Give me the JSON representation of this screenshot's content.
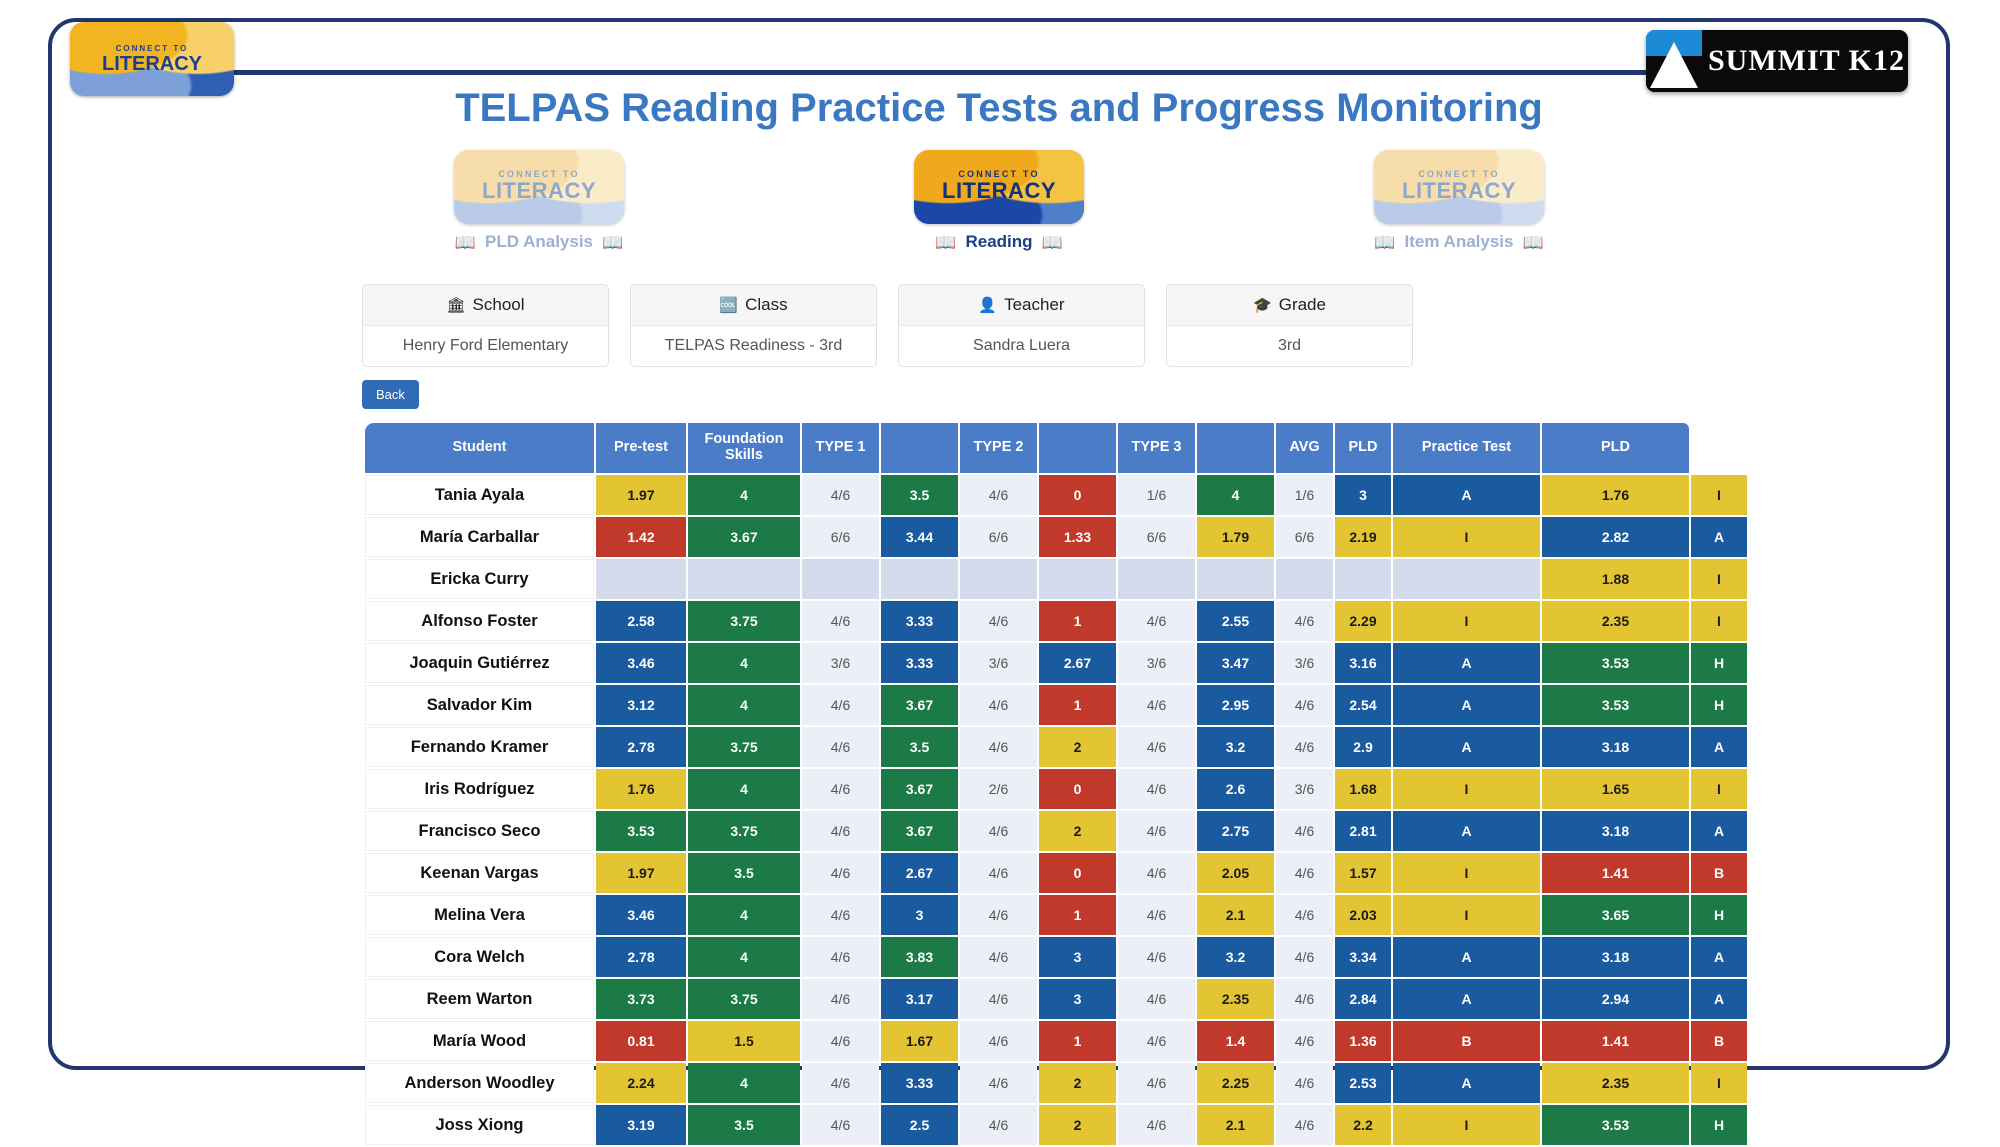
{
  "header": {
    "title": "TELPAS Reading Practice Tests and Progress Monitoring",
    "brand_logo_line1": "CONNECT TO",
    "brand_logo_line2": "LITERACY",
    "partner_logo": "SUMMIT K12"
  },
  "nav": {
    "items": [
      {
        "label": "PLD Analysis",
        "logo_line1": "CONNECT TO",
        "logo_line2": "LITERACY",
        "active": false,
        "icon": "book-icon"
      },
      {
        "label": "Reading",
        "logo_line1": "CONNECT TO",
        "logo_line2": "LITERACY",
        "active": true,
        "icon": "book-icon"
      },
      {
        "label": "Item Analysis",
        "logo_line1": "CONNECT TO",
        "logo_line2": "LITERACY",
        "active": false,
        "icon": "book-icon"
      }
    ]
  },
  "filters": [
    {
      "label": "School",
      "value": "Henry Ford Elementary",
      "icon": "bank-icon"
    },
    {
      "label": "Class",
      "value": "TELPAS Readiness - 3rd",
      "icon": "id-card-icon"
    },
    {
      "label": "Teacher",
      "value": "Sandra Luera",
      "icon": "user-icon"
    },
    {
      "label": "Grade",
      "value": "3rd",
      "icon": "graduation-cap-icon"
    }
  ],
  "back_button": "Back",
  "colors": {
    "frame": "#21366e",
    "title": "#3a78c2",
    "header_blue": "#4a7cc7",
    "cell_blue": "#1a5a9e",
    "cell_green": "#1b7a46",
    "cell_yellow": "#e3c533",
    "cell_red": "#c0392b",
    "cell_empty": "#d3daec",
    "fraction_bg": "#eceff7",
    "button_blue": "#2f6cb5"
  },
  "table": {
    "columns": [
      "Student",
      "Pre-test",
      "Foundation Skills",
      "TYPE 1",
      "",
      "TYPE 2",
      "",
      "TYPE 3",
      "",
      "AVG",
      "PLD",
      "Practice Test",
      "PLD"
    ],
    "column_headers": {
      "student": "Student",
      "pretest": "Pre-test",
      "foundation": "Foundation Skills",
      "foundation_l1": "Foundation",
      "foundation_l2": "Skills",
      "type1": "TYPE 1",
      "type2": "TYPE 2",
      "type3": "TYPE 3",
      "avg": "AVG",
      "pld": "PLD",
      "practice": "Practice Test",
      "pld2": "PLD"
    },
    "rows": [
      {
        "name": "Tania Ayala",
        "cells": [
          {
            "v": "1.97",
            "c": "c-y"
          },
          {
            "v": "4",
            "c": "c-g"
          },
          {
            "v": "4/6",
            "c": "c-f"
          },
          {
            "v": "3.5",
            "c": "c-g"
          },
          {
            "v": "4/6",
            "c": "c-f"
          },
          {
            "v": "0",
            "c": "c-r"
          },
          {
            "v": "1/6",
            "c": "c-f"
          },
          {
            "v": "4",
            "c": "c-g"
          },
          {
            "v": "1/6",
            "c": "c-f"
          },
          {
            "v": "3",
            "c": "c-b"
          },
          {
            "v": "A",
            "c": "c-b"
          },
          {
            "v": "1.76",
            "c": "c-y"
          },
          {
            "v": "I",
            "c": "c-y"
          }
        ]
      },
      {
        "name": "María Carballar",
        "cells": [
          {
            "v": "1.42",
            "c": "c-r"
          },
          {
            "v": "3.67",
            "c": "c-g"
          },
          {
            "v": "6/6",
            "c": "c-f"
          },
          {
            "v": "3.44",
            "c": "c-b"
          },
          {
            "v": "6/6",
            "c": "c-f"
          },
          {
            "v": "1.33",
            "c": "c-r"
          },
          {
            "v": "6/6",
            "c": "c-f"
          },
          {
            "v": "1.79",
            "c": "c-y"
          },
          {
            "v": "6/6",
            "c": "c-f"
          },
          {
            "v": "2.19",
            "c": "c-y"
          },
          {
            "v": "I",
            "c": "c-y"
          },
          {
            "v": "2.82",
            "c": "c-b"
          },
          {
            "v": "A",
            "c": "c-b"
          }
        ]
      },
      {
        "name": "Ericka Curry",
        "cells": [
          {
            "v": "",
            "c": "c-e"
          },
          {
            "v": "",
            "c": "c-e"
          },
          {
            "v": "",
            "c": "c-e"
          },
          {
            "v": "",
            "c": "c-e"
          },
          {
            "v": "",
            "c": "c-e"
          },
          {
            "v": "",
            "c": "c-e"
          },
          {
            "v": "",
            "c": "c-e"
          },
          {
            "v": "",
            "c": "c-e"
          },
          {
            "v": "",
            "c": "c-e"
          },
          {
            "v": "",
            "c": "c-e"
          },
          {
            "v": "",
            "c": "c-e"
          },
          {
            "v": "1.88",
            "c": "c-y"
          },
          {
            "v": "I",
            "c": "c-y"
          }
        ]
      },
      {
        "name": "Alfonso Foster",
        "cells": [
          {
            "v": "2.58",
            "c": "c-b"
          },
          {
            "v": "3.75",
            "c": "c-g"
          },
          {
            "v": "4/6",
            "c": "c-f"
          },
          {
            "v": "3.33",
            "c": "c-b"
          },
          {
            "v": "4/6",
            "c": "c-f"
          },
          {
            "v": "1",
            "c": "c-r"
          },
          {
            "v": "4/6",
            "c": "c-f"
          },
          {
            "v": "2.55",
            "c": "c-b"
          },
          {
            "v": "4/6",
            "c": "c-f"
          },
          {
            "v": "2.29",
            "c": "c-y"
          },
          {
            "v": "I",
            "c": "c-y"
          },
          {
            "v": "2.35",
            "c": "c-y"
          },
          {
            "v": "I",
            "c": "c-y"
          }
        ]
      },
      {
        "name": "Joaquin Gutiérrez",
        "cells": [
          {
            "v": "3.46",
            "c": "c-b"
          },
          {
            "v": "4",
            "c": "c-g"
          },
          {
            "v": "3/6",
            "c": "c-f"
          },
          {
            "v": "3.33",
            "c": "c-b"
          },
          {
            "v": "3/6",
            "c": "c-f"
          },
          {
            "v": "2.67",
            "c": "c-b"
          },
          {
            "v": "3/6",
            "c": "c-f"
          },
          {
            "v": "3.47",
            "c": "c-b"
          },
          {
            "v": "3/6",
            "c": "c-f"
          },
          {
            "v": "3.16",
            "c": "c-b"
          },
          {
            "v": "A",
            "c": "c-b"
          },
          {
            "v": "3.53",
            "c": "c-g"
          },
          {
            "v": "H",
            "c": "c-g"
          }
        ]
      },
      {
        "name": "Salvador Kim",
        "cells": [
          {
            "v": "3.12",
            "c": "c-b"
          },
          {
            "v": "4",
            "c": "c-g"
          },
          {
            "v": "4/6",
            "c": "c-f"
          },
          {
            "v": "3.67",
            "c": "c-g"
          },
          {
            "v": "4/6",
            "c": "c-f"
          },
          {
            "v": "1",
            "c": "c-r"
          },
          {
            "v": "4/6",
            "c": "c-f"
          },
          {
            "v": "2.95",
            "c": "c-b"
          },
          {
            "v": "4/6",
            "c": "c-f"
          },
          {
            "v": "2.54",
            "c": "c-b"
          },
          {
            "v": "A",
            "c": "c-b"
          },
          {
            "v": "3.53",
            "c": "c-g"
          },
          {
            "v": "H",
            "c": "c-g"
          }
        ]
      },
      {
        "name": "Fernando Kramer",
        "cells": [
          {
            "v": "2.78",
            "c": "c-b"
          },
          {
            "v": "3.75",
            "c": "c-g"
          },
          {
            "v": "4/6",
            "c": "c-f"
          },
          {
            "v": "3.5",
            "c": "c-g"
          },
          {
            "v": "4/6",
            "c": "c-f"
          },
          {
            "v": "2",
            "c": "c-y"
          },
          {
            "v": "4/6",
            "c": "c-f"
          },
          {
            "v": "3.2",
            "c": "c-b"
          },
          {
            "v": "4/6",
            "c": "c-f"
          },
          {
            "v": "2.9",
            "c": "c-b"
          },
          {
            "v": "A",
            "c": "c-b"
          },
          {
            "v": "3.18",
            "c": "c-b"
          },
          {
            "v": "A",
            "c": "c-b"
          }
        ]
      },
      {
        "name": "Iris Rodríguez",
        "cells": [
          {
            "v": "1.76",
            "c": "c-y"
          },
          {
            "v": "4",
            "c": "c-g"
          },
          {
            "v": "4/6",
            "c": "c-f"
          },
          {
            "v": "3.67",
            "c": "c-g"
          },
          {
            "v": "2/6",
            "c": "c-f"
          },
          {
            "v": "0",
            "c": "c-r"
          },
          {
            "v": "4/6",
            "c": "c-f"
          },
          {
            "v": "2.6",
            "c": "c-b"
          },
          {
            "v": "3/6",
            "c": "c-f"
          },
          {
            "v": "1.68",
            "c": "c-y"
          },
          {
            "v": "I",
            "c": "c-y"
          },
          {
            "v": "1.65",
            "c": "c-y"
          },
          {
            "v": "I",
            "c": "c-y"
          }
        ]
      },
      {
        "name": "Francisco Seco",
        "cells": [
          {
            "v": "3.53",
            "c": "c-g"
          },
          {
            "v": "3.75",
            "c": "c-g"
          },
          {
            "v": "4/6",
            "c": "c-f"
          },
          {
            "v": "3.67",
            "c": "c-g"
          },
          {
            "v": "4/6",
            "c": "c-f"
          },
          {
            "v": "2",
            "c": "c-y"
          },
          {
            "v": "4/6",
            "c": "c-f"
          },
          {
            "v": "2.75",
            "c": "c-b"
          },
          {
            "v": "4/6",
            "c": "c-f"
          },
          {
            "v": "2.81",
            "c": "c-b"
          },
          {
            "v": "A",
            "c": "c-b"
          },
          {
            "v": "3.18",
            "c": "c-b"
          },
          {
            "v": "A",
            "c": "c-b"
          }
        ]
      },
      {
        "name": "Keenan Vargas",
        "cells": [
          {
            "v": "1.97",
            "c": "c-y"
          },
          {
            "v": "3.5",
            "c": "c-g"
          },
          {
            "v": "4/6",
            "c": "c-f"
          },
          {
            "v": "2.67",
            "c": "c-b"
          },
          {
            "v": "4/6",
            "c": "c-f"
          },
          {
            "v": "0",
            "c": "c-r"
          },
          {
            "v": "4/6",
            "c": "c-f"
          },
          {
            "v": "2.05",
            "c": "c-y"
          },
          {
            "v": "4/6",
            "c": "c-f"
          },
          {
            "v": "1.57",
            "c": "c-y"
          },
          {
            "v": "I",
            "c": "c-y"
          },
          {
            "v": "1.41",
            "c": "c-r"
          },
          {
            "v": "B",
            "c": "c-r"
          }
        ]
      },
      {
        "name": "Melina Vera",
        "cells": [
          {
            "v": "3.46",
            "c": "c-b"
          },
          {
            "v": "4",
            "c": "c-g"
          },
          {
            "v": "4/6",
            "c": "c-f"
          },
          {
            "v": "3",
            "c": "c-b"
          },
          {
            "v": "4/6",
            "c": "c-f"
          },
          {
            "v": "1",
            "c": "c-r"
          },
          {
            "v": "4/6",
            "c": "c-f"
          },
          {
            "v": "2.1",
            "c": "c-y"
          },
          {
            "v": "4/6",
            "c": "c-f"
          },
          {
            "v": "2.03",
            "c": "c-y"
          },
          {
            "v": "I",
            "c": "c-y"
          },
          {
            "v": "3.65",
            "c": "c-g"
          },
          {
            "v": "H",
            "c": "c-g"
          }
        ]
      },
      {
        "name": "Cora Welch",
        "cells": [
          {
            "v": "2.78",
            "c": "c-b"
          },
          {
            "v": "4",
            "c": "c-g"
          },
          {
            "v": "4/6",
            "c": "c-f"
          },
          {
            "v": "3.83",
            "c": "c-g"
          },
          {
            "v": "4/6",
            "c": "c-f"
          },
          {
            "v": "3",
            "c": "c-b"
          },
          {
            "v": "4/6",
            "c": "c-f"
          },
          {
            "v": "3.2",
            "c": "c-b"
          },
          {
            "v": "4/6",
            "c": "c-f"
          },
          {
            "v": "3.34",
            "c": "c-b"
          },
          {
            "v": "A",
            "c": "c-b"
          },
          {
            "v": "3.18",
            "c": "c-b"
          },
          {
            "v": "A",
            "c": "c-b"
          }
        ]
      },
      {
        "name": "Reem Warton",
        "cells": [
          {
            "v": "3.73",
            "c": "c-g"
          },
          {
            "v": "3.75",
            "c": "c-g"
          },
          {
            "v": "4/6",
            "c": "c-f"
          },
          {
            "v": "3.17",
            "c": "c-b"
          },
          {
            "v": "4/6",
            "c": "c-f"
          },
          {
            "v": "3",
            "c": "c-b"
          },
          {
            "v": "4/6",
            "c": "c-f"
          },
          {
            "v": "2.35",
            "c": "c-y"
          },
          {
            "v": "4/6",
            "c": "c-f"
          },
          {
            "v": "2.84",
            "c": "c-b"
          },
          {
            "v": "A",
            "c": "c-b"
          },
          {
            "v": "2.94",
            "c": "c-b"
          },
          {
            "v": "A",
            "c": "c-b"
          }
        ]
      },
      {
        "name": "María Wood",
        "cells": [
          {
            "v": "0.81",
            "c": "c-r"
          },
          {
            "v": "1.5",
            "c": "c-y"
          },
          {
            "v": "4/6",
            "c": "c-f"
          },
          {
            "v": "1.67",
            "c": "c-y"
          },
          {
            "v": "4/6",
            "c": "c-f"
          },
          {
            "v": "1",
            "c": "c-r"
          },
          {
            "v": "4/6",
            "c": "c-f"
          },
          {
            "v": "1.4",
            "c": "c-r"
          },
          {
            "v": "4/6",
            "c": "c-f"
          },
          {
            "v": "1.36",
            "c": "c-r"
          },
          {
            "v": "B",
            "c": "c-r"
          },
          {
            "v": "1.41",
            "c": "c-r"
          },
          {
            "v": "B",
            "c": "c-r"
          }
        ]
      },
      {
        "name": "Anderson Woodley",
        "cells": [
          {
            "v": "2.24",
            "c": "c-y"
          },
          {
            "v": "4",
            "c": "c-g"
          },
          {
            "v": "4/6",
            "c": "c-f"
          },
          {
            "v": "3.33",
            "c": "c-b"
          },
          {
            "v": "4/6",
            "c": "c-f"
          },
          {
            "v": "2",
            "c": "c-y"
          },
          {
            "v": "4/6",
            "c": "c-f"
          },
          {
            "v": "2.25",
            "c": "c-y"
          },
          {
            "v": "4/6",
            "c": "c-f"
          },
          {
            "v": "2.53",
            "c": "c-b"
          },
          {
            "v": "A",
            "c": "c-b"
          },
          {
            "v": "2.35",
            "c": "c-y"
          },
          {
            "v": "I",
            "c": "c-y"
          }
        ]
      },
      {
        "name": "Joss Xiong",
        "cells": [
          {
            "v": "3.19",
            "c": "c-b"
          },
          {
            "v": "3.5",
            "c": "c-g"
          },
          {
            "v": "4/6",
            "c": "c-f"
          },
          {
            "v": "2.5",
            "c": "c-b"
          },
          {
            "v": "4/6",
            "c": "c-f"
          },
          {
            "v": "2",
            "c": "c-y"
          },
          {
            "v": "4/6",
            "c": "c-f"
          },
          {
            "v": "2.1",
            "c": "c-y"
          },
          {
            "v": "4/6",
            "c": "c-f"
          },
          {
            "v": "2.2",
            "c": "c-y"
          },
          {
            "v": "I",
            "c": "c-y"
          },
          {
            "v": "3.53",
            "c": "c-g"
          },
          {
            "v": "H",
            "c": "c-g"
          }
        ]
      }
    ]
  }
}
